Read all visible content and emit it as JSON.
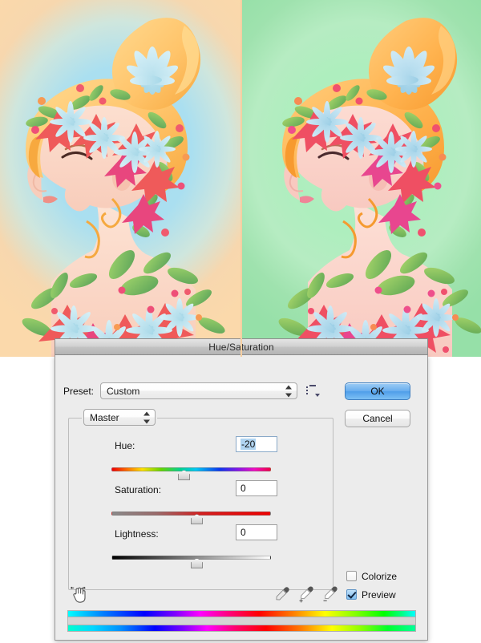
{
  "previews": {
    "left": {
      "name": "original-image",
      "description": "Illustration of a woman in profile with blonde bun hair and a flower crown, on blue-to-peach gradient background",
      "bg_center": "#a9dcee",
      "bg_edge": "#fbd9ab"
    },
    "right": {
      "name": "adjusted-image",
      "description": "Same illustration with hue shifted -20, on green gradient background",
      "bg_center": "#b5f0c4",
      "bg_edge": "#96e0a8"
    },
    "divider_color": "#f5cfa2"
  },
  "dialog": {
    "title": "Hue/Saturation",
    "preset": {
      "label": "Preset:",
      "value": "Custom",
      "menu_icon": "preset-options-icon"
    },
    "buttons": {
      "ok": "OK",
      "cancel": "Cancel"
    },
    "channel": {
      "value": "Master"
    },
    "sliders": [
      {
        "label": "Hue:",
        "value": "-20",
        "selected": true,
        "min": -180,
        "max": 180,
        "thumb_percent": 44.4,
        "track": "hue"
      },
      {
        "label": "Saturation:",
        "value": "0",
        "selected": false,
        "min": -100,
        "max": 100,
        "thumb_percent": 50,
        "track": "saturation"
      },
      {
        "label": "Lightness:",
        "value": "0",
        "selected": false,
        "min": -100,
        "max": 100,
        "thumb_percent": 50,
        "track": "lightness"
      }
    ],
    "tools": {
      "hand": "scrubby-hand-icon",
      "eyedroppers": [
        "eyedropper-icon",
        "eyedropper-add-icon",
        "eyedropper-subtract-icon"
      ]
    },
    "checkboxes": [
      {
        "label": "Colorize",
        "checked": false
      },
      {
        "label": "Preview",
        "checked": true
      }
    ],
    "color_bars": {
      "top_label": "hue-range-bar-source",
      "middle_label": "hue-range-selector-bar",
      "bottom_label": "hue-range-bar-result"
    },
    "accent": "#4f9ee9",
    "selection_color": "#b0d4f1",
    "background": "#ececec"
  }
}
